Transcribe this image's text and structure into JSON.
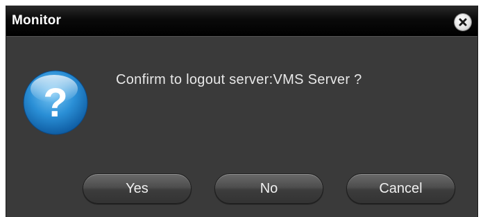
{
  "dialog": {
    "title": "Monitor",
    "message": "Confirm to logout server:VMS Server ?",
    "icons": {
      "close": "close-icon",
      "question": "question-icon"
    },
    "buttons": {
      "yes": "Yes",
      "no": "No",
      "cancel": "Cancel"
    },
    "colors": {
      "background": "#3a3a3a",
      "titlebar": "#000000",
      "question_icon": "#2a8fd6"
    }
  }
}
